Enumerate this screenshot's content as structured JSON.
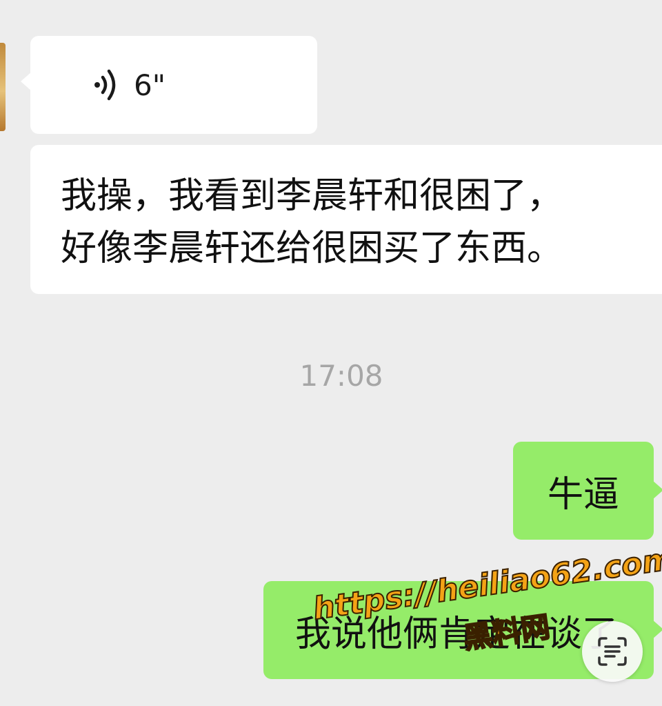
{
  "messages": [
    {
      "id": "m1",
      "side": "in",
      "type": "voice",
      "duration": "6\""
    },
    {
      "id": "m2",
      "side": "in",
      "type": "text",
      "lines": [
        "我操，我看到李晨轩和很困了，",
        "好像李晨轩还给很困买了东西。"
      ]
    },
    {
      "id": "m3",
      "side": "out",
      "type": "text",
      "text": "牛逼"
    },
    {
      "id": "m4",
      "side": "out",
      "type": "text",
      "text": "我说他俩肯定在谈了"
    }
  ],
  "timestamp": "17:08",
  "watermark": {
    "url": "https://heiliao62.com",
    "name": "黑料网"
  },
  "icons": {
    "voice": "voice-wave-icon",
    "scan": "text-scan-icon"
  },
  "colors": {
    "background": "#ededed",
    "incoming_bubble": "#ffffff",
    "outgoing_bubble": "#95ec69",
    "timestamp": "#a6a6a6",
    "watermark": "#f4a316"
  }
}
